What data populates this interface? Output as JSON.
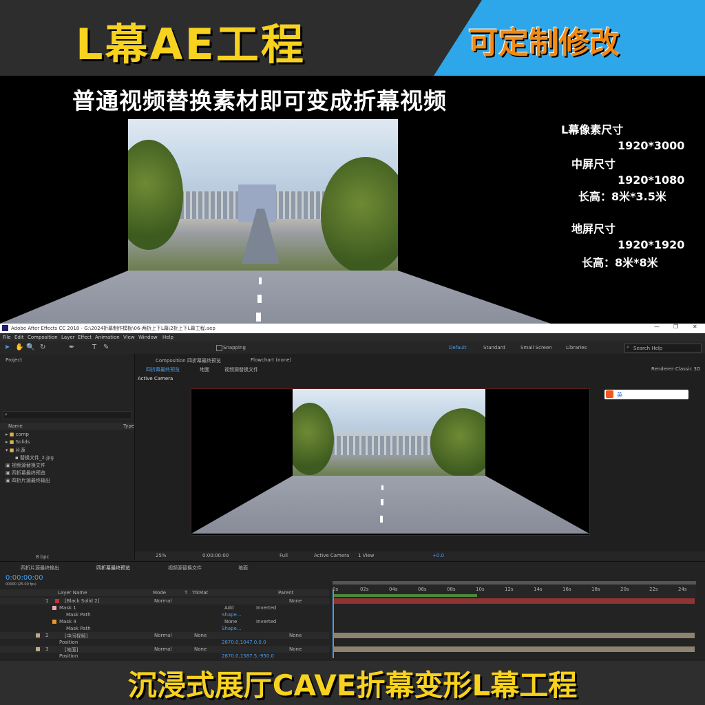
{
  "banner": {
    "title": "L幕AE工程",
    "tag": "可定制修改"
  },
  "subtitle": "普通视频替换素材即可变成折幕视频",
  "specs": {
    "l_title": "L幕像素尺寸",
    "l_size": "1920*3000",
    "mid_title": "中屏尺寸",
    "mid_size": "1920*1080",
    "mid_dim": "长高：8米*3.5米",
    "floor_title": "地屏尺寸",
    "floor_size": "1920*1920",
    "floor_dim": "长高：8米*8米"
  },
  "ae": {
    "window_title": "Adobe After Effects CC 2018 - G:\\2024折幕制作模板\\06-两折上下L幕\\2折上下L幕工程.aep",
    "menus": [
      "File",
      "Edit",
      "Composition",
      "Layer",
      "Effect",
      "Animation",
      "View",
      "Window",
      "Help"
    ],
    "snapping": "Snapping",
    "workspaces": [
      "Default",
      "Standard",
      "Small Screen",
      "Libraries"
    ],
    "search_placeholder": "Search Help",
    "project_label": "Project",
    "comp_tab": "Composition 四折幕最终预览",
    "flowchart_tab": "Flowchart (none)",
    "crumbs": [
      "四折幕最终预览",
      "地面",
      "视频源替换文件"
    ],
    "renderer_label": "Renderer:",
    "renderer_value": "Classic 3D",
    "active_camera": "Active Camera",
    "col_name": "Name",
    "col_type": "Type",
    "project_items": [
      "comp",
      "Solids",
      "片源",
      "替换文件_2.jpg",
      "视频源替换文件",
      "四折幕最终预览",
      "四折片源最终输出"
    ],
    "bpc": "8 bpc",
    "viewer_zoom": "25%",
    "viewer_time": "0:00:00:00",
    "viewer_res": "Full",
    "viewer_cam": "Active Camera",
    "viewer_views": "1 View",
    "exposure": "+0.0",
    "ime_label": "英",
    "timeline_tabs": [
      "四折片源最终输出",
      "四折幕最终预览",
      "视频源替换文件",
      "地面"
    ],
    "timecode": "0:00:00:00",
    "fps": "00000 (25.00 fps)",
    "headers": {
      "source": "Layer Name",
      "mode": "Mode",
      "t": "T",
      "trkmat": "TrkMat",
      "parent": "Parent"
    },
    "ruler": [
      "0s",
      "02s",
      "04s",
      "06s",
      "08s",
      "10s",
      "12s",
      "14s",
      "16s",
      "18s",
      "20s",
      "22s",
      "24s"
    ],
    "rows": [
      {
        "num": "1",
        "name": "[Black Solid 2]",
        "mode": "Normal",
        "trk": "",
        "parent": "None"
      },
      {
        "num": "",
        "name": "Mask 1",
        "mode": "Add",
        "trk": "Inverted",
        "parent": ""
      },
      {
        "num": "",
        "name": "Mask Path",
        "mode": "Shape...",
        "trk": "",
        "parent": ""
      },
      {
        "num": "",
        "name": "Mask 4",
        "mode": "None",
        "trk": "Inverted",
        "parent": ""
      },
      {
        "num": "",
        "name": "Mask Path",
        "mode": "Shape...",
        "trk": "",
        "parent": ""
      },
      {
        "num": "2",
        "name": "[中间视频]",
        "mode": "Normal",
        "trk": "None",
        "parent": "None"
      },
      {
        "num": "",
        "name": "Position",
        "mode": "2870.0,1047.0,0.0",
        "trk": "",
        "parent": ""
      },
      {
        "num": "3",
        "name": "[地面]",
        "mode": "Normal",
        "trk": "None",
        "parent": "None"
      },
      {
        "num": "",
        "name": "Position",
        "mode": "2870.0,1587.5,-950.0",
        "trk": "",
        "parent": ""
      }
    ]
  },
  "bottom_title": "沉浸式展厅CAVE折幕变形L幕工程"
}
